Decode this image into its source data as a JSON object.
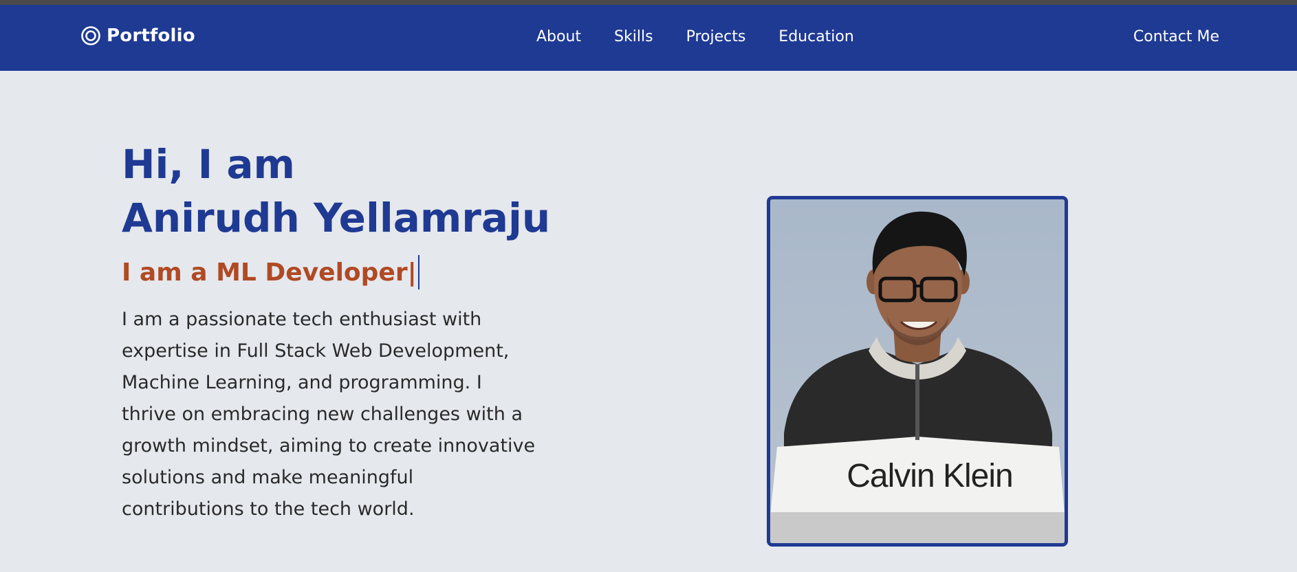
{
  "nav": {
    "brand": "Portfolio",
    "brand_icon": "target-icon",
    "links": [
      "About",
      "Skills",
      "Projects",
      "Education"
    ],
    "contact": "Contact Me"
  },
  "hero": {
    "greeting_line1": "Hi, I am",
    "greeting_line2": "Anirudh Yellamraju",
    "typed_text": "I am a ML Developer|",
    "bio": "I am a passionate tech enthusiast with expertise in Full Stack Web Development, Machine Learning, and programming. I thrive on embracing new challenges with a growth mindset, aiming to create innovative solutions and make meaningful contributions to the tech world.",
    "photo": {
      "sweatshirt_text": "Calvin Klein"
    }
  },
  "colors": {
    "nav_bg": "#1f3a93",
    "page_bg": "#e5e8ed",
    "heading": "#1f3a93",
    "accent": "#b04a24",
    "body_text": "#2a2a2a"
  }
}
